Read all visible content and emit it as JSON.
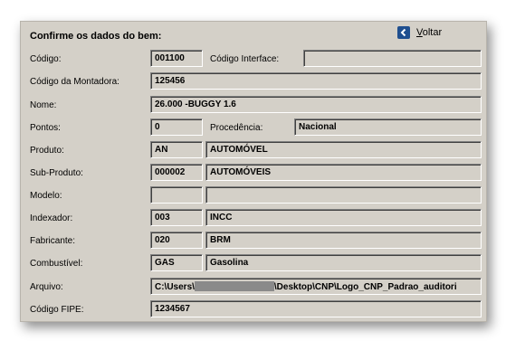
{
  "form": {
    "title": "Confirme os dados do bem:",
    "back_prefix": "V",
    "back_rest": "oltar"
  },
  "labels": {
    "codigo": "Código:",
    "codigo_interface": "Código Interface:",
    "codigo_montadora": "Código da Montadora:",
    "nome": "Nome:",
    "pontos": "Pontos:",
    "procedencia": "Procedência:",
    "produto": "Produto:",
    "sub_produto": "Sub-Produto:",
    "modelo": "Modelo:",
    "indexador": "Indexador:",
    "fabricante": "Fabricante:",
    "combustivel": "Combustível:",
    "arquivo": "Arquivo:",
    "codigo_fipe": "Código FIPE:"
  },
  "values": {
    "codigo": "001100",
    "codigo_interface": "",
    "codigo_montadora": "125456",
    "nome": "26.000 -BUGGY 1.6",
    "pontos": "0",
    "procedencia": "Nacional",
    "produto_code": "AN",
    "produto_desc": "AUTOMÓVEL",
    "sub_produto_code": "000002",
    "sub_produto_desc": "AUTOMÓVEIS",
    "modelo_code": "",
    "modelo_desc": "",
    "indexador_code": "003",
    "indexador_desc": "INCC",
    "fabricante_code": "020",
    "fabricante_desc": "BRM",
    "combustivel_code": "GAS",
    "combustivel_desc": "Gasolina",
    "arquivo_prefix": "C:\\Users\\",
    "arquivo_suffix": "\\Desktop\\CNP\\Logo_CNP_Padrao_auditori",
    "codigo_fipe": "1234567"
  }
}
